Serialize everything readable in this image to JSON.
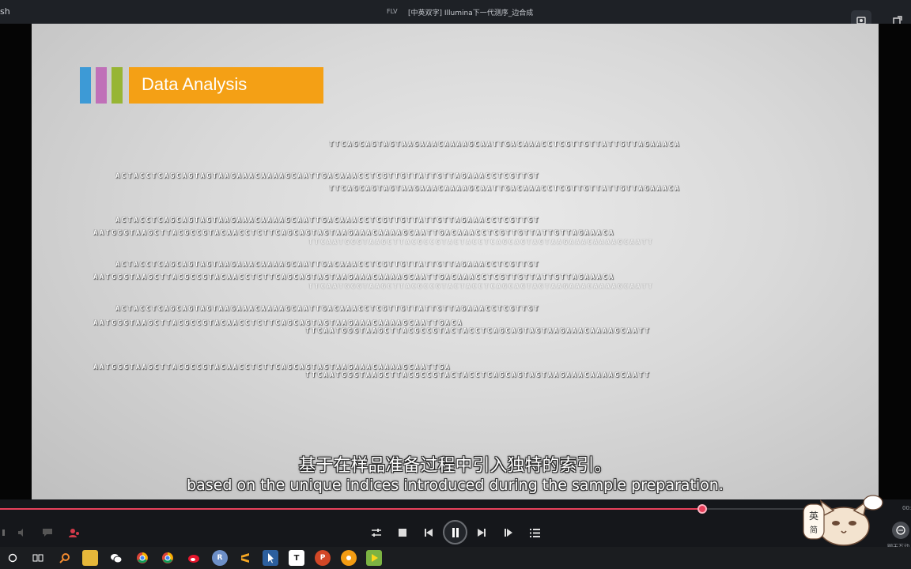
{
  "topbar": {
    "app_fragment": "sh",
    "format": "FLV",
    "title": "[中英双字] Illumina下一代测序_边合成"
  },
  "slide": {
    "heading": "Data Analysis",
    "colors": {
      "bar1": "#3d9ad6",
      "bar2": "#c070b8",
      "bar3": "#97b534",
      "heading_bg": "#f4a015"
    },
    "sequences": [
      "TTCAGCAGTAGTAAGAAACAAAAGCAATTGACAAACCTCGTTGTTATTGTTAGAAACA",
      "ACTACCTCAGCAGTAGTAAGAAACAAAAGCAATTGACAAACCTCGTTGTTATTGTTAGAAACCTCGTTGT",
      "TTCAGCAGTAGTAAGAAACAAAAGCAATTGACAAACCTCGTTGTTATTGTTAGAAACA",
      "ACTACCTCAGCAGTAGTAAGAAACAAAAGCAATTGACAAACCTCGTTGTTATTGTTAGAAACCTCGTTGT",
      "AATGGGTAAGCTTACGCCGTACAACCTCTTCAGCAGTAGTAAGAAACAAAAGCAATTGACAAACCTCGTTGTTATTGTTAGAAACA",
      "TTCAATGGGTAAGCTTACGCCGTACTACCTCAGCAGTAGTAAGAAACAAAAGCAATT",
      "ACTACCTCAGCAGTAGTAAGAAACAAAAGCAATTGACAAACCTCGTTGTTATTGTTAGAAACCTCGTTGT",
      "AATGGGTAAGCTTACGCCGTACAACCTCTTCAGCAGTAGTAAGAAACAAAAGCAATTGACAAACCTCGTTGTTATTGTTAGAAACA",
      "TTCAATGGGTAAGCTTACGCCGTACTACCTCAGCAGTAGTAAGAAACAAAAGCAATT",
      "ACTACCTCAGCAGTAGTAAGAAACAAAAGCAATTGACAAACCTCGTTGTTATTGTTAGAAACCTCGTTGT",
      "AATGGGTAAGCTTACGCCGTACAACCTCTTCAGCAGTAGTAAGAAACAAAAGCAATTGACA",
      "TTCAATGGGTAAGCTTACGCCGTACTACCTCAGCAGTAGTAAGAAACAAAAGCAATT",
      "AATGGGTAAGCTTACGCCGTACAACCTCTTCAGCAGTAGTAAGAAACAAAAGCAATTGA",
      "TTCAATGGGTAAGCTTACGCCGTACTACCTCAGCAGTAGTAAGAAACAAAAGCAATT"
    ]
  },
  "subtitles": {
    "chinese": "基于在样品准备过程中引入独特的索引。",
    "english": "based on the unique indices introduced during the sample preparation."
  },
  "player": {
    "progress_fraction": 0.804,
    "time_fragment": "00:",
    "chat_label": "聊天互动",
    "mascot_text": "英 简"
  },
  "taskbar": {
    "icons": [
      "cortana-icon",
      "task-view-icon",
      "search-app-icon",
      "file-explorer-icon",
      "wechat-icon",
      "chrome-icon",
      "chrome-alt-icon",
      "weibo-icon",
      "r-icon",
      "sublime-icon",
      "pin-icon",
      "typora-icon",
      "powerpoint-icon",
      "orange-app-icon",
      "player-app-icon"
    ]
  }
}
